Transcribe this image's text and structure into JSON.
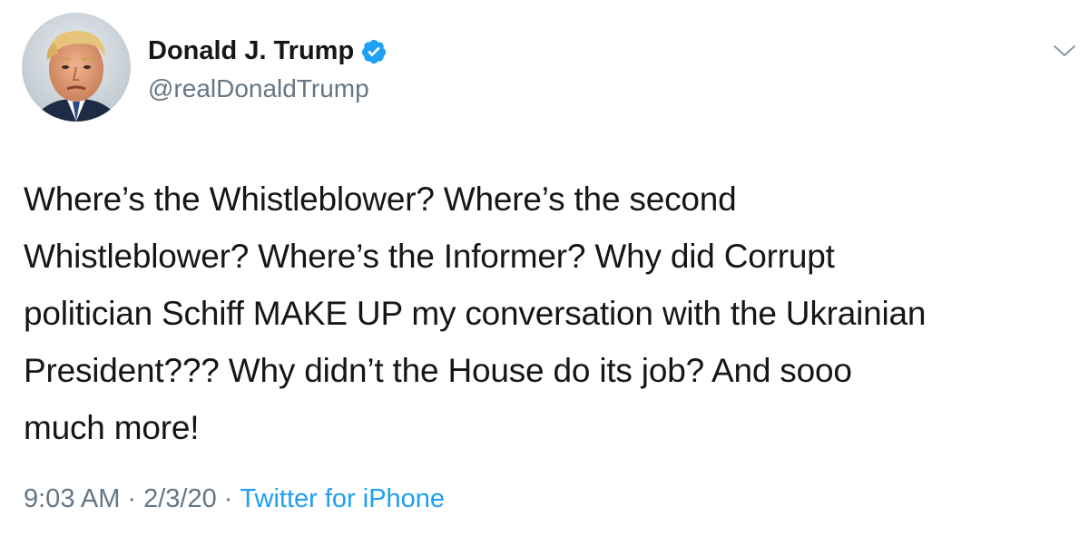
{
  "author": {
    "name": "Donald J. Trump",
    "handle": "@realDonaldTrump",
    "verified": true,
    "avatar_icon": "profile-photo"
  },
  "tweet": {
    "text": "Where’s the Whistleblower? Where’s the second\nWhistleblower? Where’s the Informer? Why did Corrupt\npolitician Schiff MAKE UP my conversation with the Ukrainian\nPresident??? Why didn’t the House do its job? And sooo\nmuch more!"
  },
  "meta": {
    "time": "9:03 AM",
    "date": "2/3/20",
    "separator": "·",
    "source": "Twitter for iPhone"
  },
  "colors": {
    "text_primary": "#14171a",
    "text_secondary": "#657786",
    "accent": "#1da1f2"
  },
  "icons": {
    "verified": "verified-badge-icon",
    "menu": "chevron-down-icon"
  }
}
